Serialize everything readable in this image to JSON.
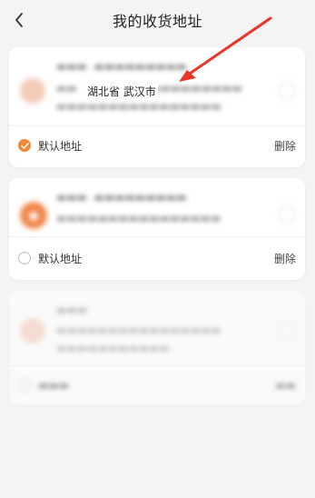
{
  "header": {
    "title": "我的收货地址"
  },
  "annotation": {
    "region_text": "湖北省 武汉市",
    "arrow_color": "#e8362a"
  },
  "cards": [
    {
      "default_label": "默认地址",
      "delete_label": "删除",
      "is_default": true
    },
    {
      "default_label": "默认地址",
      "delete_label": "删除",
      "is_default": false
    },
    {
      "default_label": "",
      "delete_label": "",
      "is_default": false
    }
  ],
  "colors": {
    "accent": "#f08a37",
    "background": "#f4f4f6"
  }
}
